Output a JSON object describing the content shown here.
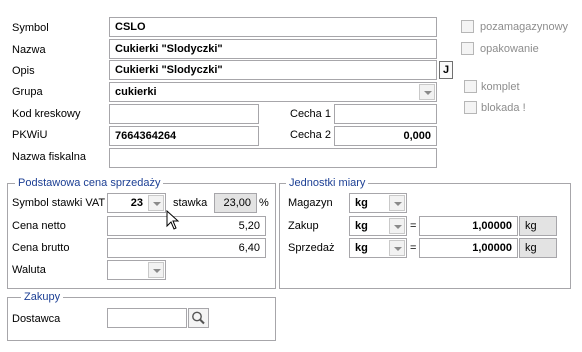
{
  "labels": {
    "symbol": "Symbol",
    "nazwa": "Nazwa",
    "opis": "Opis",
    "grupa": "Grupa",
    "kod_kreskowy": "Kod kreskowy",
    "pkwiu": "PKWiU",
    "nazwa_fiskalna": "Nazwa fiskalna",
    "cecha1": "Cecha 1",
    "cecha2": "Cecha 2"
  },
  "values": {
    "symbol": "CSLO",
    "nazwa": "Cukierki \"Slodyczki\"",
    "opis": "Cukierki \"Slodyczki\"",
    "grupa": "cukierki",
    "kod_kreskowy": "",
    "pkwiu": "7664364264",
    "nazwa_fiskalna": "",
    "cecha1": "",
    "cecha2": "0,000"
  },
  "j_button": "J",
  "checkboxes": {
    "pozamagazynowy": "pozamagazynowy",
    "opakowanie": "opakowanie",
    "komplet": "komplet",
    "blokada": "blokada !"
  },
  "price_group": {
    "title": "Podstawowa cena sprzedaży",
    "vat_label": "Symbol stawki VAT",
    "vat_value": "23",
    "stawka_label": "stawka",
    "stawka_value": "23,00",
    "percent": "%",
    "netto_label": "Cena netto",
    "netto_value": "5,20",
    "brutto_label": "Cena brutto",
    "brutto_value": "6,40",
    "waluta_label": "Waluta",
    "waluta_value": ""
  },
  "units_group": {
    "title": "Jednostki miary",
    "magazyn_label": "Magazyn",
    "magazyn_value": "kg",
    "zakup_label": "Zakup",
    "zakup_value": "kg",
    "zakup_eq": "=",
    "zakup_factor": "1,00000",
    "zakup_unit": "kg",
    "sprzedaz_label": "Sprzedaż",
    "sprzedaz_value": "kg",
    "sprzedaz_eq": "=",
    "sprzedaz_factor": "1,00000",
    "sprzedaz_unit": "kg"
  },
  "purchases_group": {
    "title": "Zakupy",
    "dostawca_label": "Dostawca",
    "dostawca_value": ""
  }
}
